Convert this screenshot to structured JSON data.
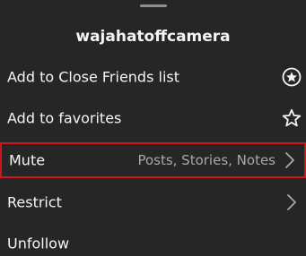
{
  "sheet": {
    "username": "wajahatoffcamera"
  },
  "menu": {
    "items": [
      {
        "label": "Add to Close Friends list",
        "icon": "close-friends-star-icon"
      },
      {
        "label": "Add to favorites",
        "icon": "star-outline-icon"
      },
      {
        "label": "Mute",
        "meta": "Posts, Stories, Notes",
        "icon": "chevron-right-icon",
        "highlighted": true
      },
      {
        "label": "Restrict",
        "icon": "chevron-right-icon"
      },
      {
        "label": "Unfollow"
      }
    ]
  },
  "colors": {
    "background": "#262626",
    "text": "#f5f5f5",
    "secondary_text": "#a8a8a8",
    "highlight_border": "#d0161b"
  }
}
